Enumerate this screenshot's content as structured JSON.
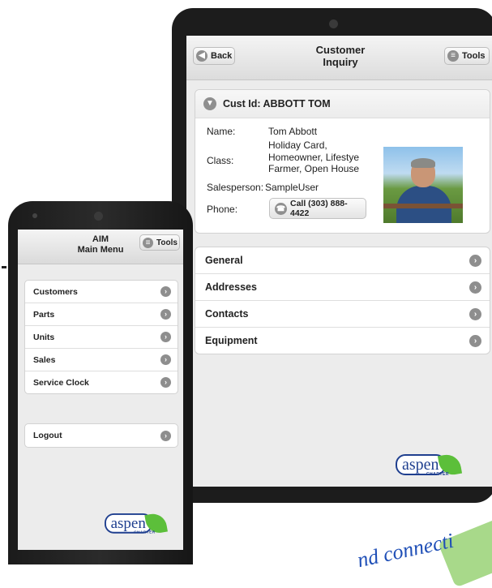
{
  "tablet": {
    "header": {
      "title_line1": "Customer",
      "title_line2": "Inquiry",
      "back_label": "Back",
      "tools_label": "Tools"
    },
    "customer": {
      "heading": "Cust Id: ABBOTT TOM",
      "name_label": "Name:",
      "name_value": "Tom Abbott",
      "class_label": "Class:",
      "class_value_lines": [
        "Holiday Card,",
        "Homeowner, Lifestye",
        "Farmer, Open House"
      ],
      "salesperson_label": "Salesperson:",
      "salesperson_value": "SampleUser",
      "phone_label": "Phone:",
      "call_label": "Call (303) 888-4422"
    },
    "sections": [
      "General",
      "Addresses",
      "Contacts",
      "Equipment"
    ]
  },
  "phone": {
    "header": {
      "title_line1": "AIM",
      "title_line2": "Main Menu",
      "tools_label": "Tools"
    },
    "menu": [
      "Customers",
      "Parts",
      "Units",
      "Sales",
      "Service Clock"
    ],
    "logout": "Logout"
  },
  "brand": {
    "logo_text": "aspen",
    "logo_subtext": "CHARTER",
    "accent": "#5cbf3a",
    "brand_blue": "#1f3f8f"
  },
  "slogan": "nd connecti",
  "icons": {
    "arrow": "chevron-right-icon",
    "back": "back-arrow-icon",
    "tools": "menu-icon",
    "call": "phone-icon",
    "expand": "chevron-down-icon"
  }
}
